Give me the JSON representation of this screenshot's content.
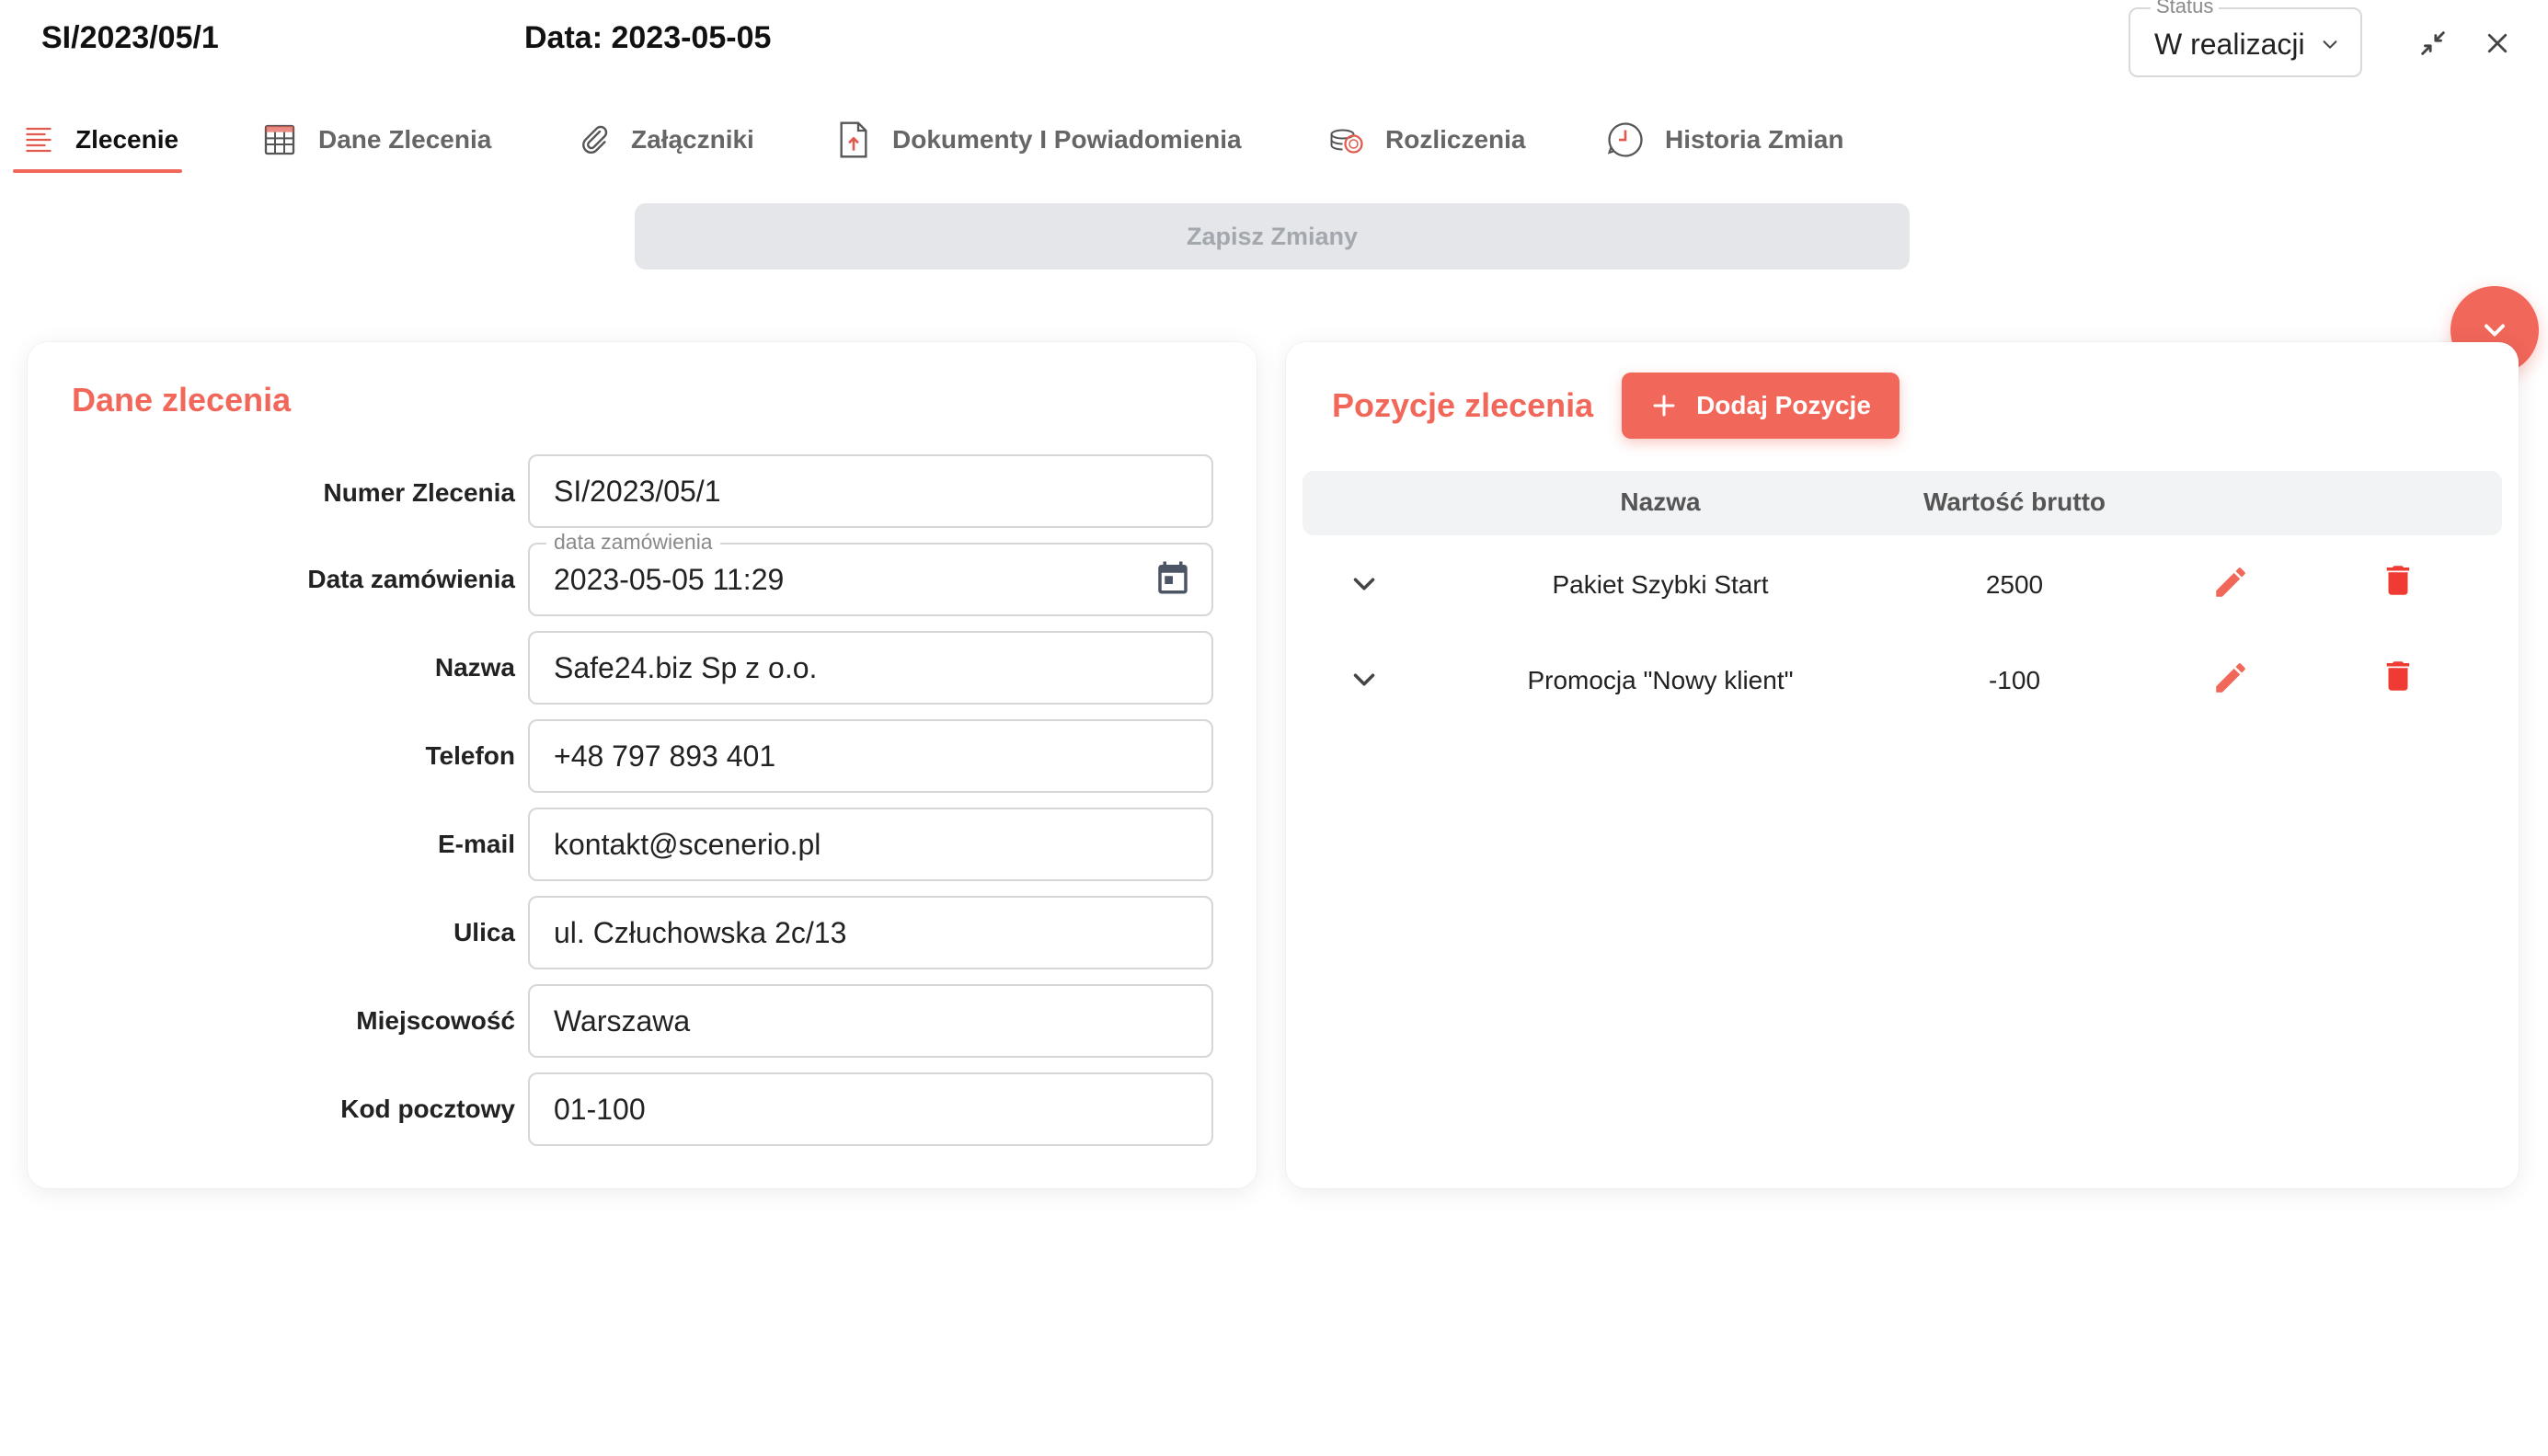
{
  "header": {
    "order_number": "SI/2023/05/1",
    "date_text": "Data: 2023-05-05",
    "status_label": "Status",
    "status_value": "W realizacji"
  },
  "tabs": [
    {
      "label": "Zlecenie",
      "icon": "list-lines-icon",
      "active": true
    },
    {
      "label": "Dane Zlecenia",
      "icon": "table-grid-icon",
      "active": false
    },
    {
      "label": "Załączniki",
      "icon": "paperclip-icon",
      "active": false
    },
    {
      "label": "Dokumenty I Powiadomienia",
      "icon": "document-upload-icon",
      "active": false
    },
    {
      "label": "Rozliczenia",
      "icon": "coins-icon",
      "active": false
    },
    {
      "label": "Historia Zmian",
      "icon": "history-clock-icon",
      "active": false
    }
  ],
  "save_button": "Zapisz Zmiany",
  "order_form": {
    "title": "Dane zlecenia",
    "fields": [
      {
        "label": "Numer Zlecenia",
        "value": "SI/2023/05/1"
      },
      {
        "label": "Data zamówienia",
        "value": "2023-05-05 11:29",
        "floating_label": "data zamówienia"
      },
      {
        "label": "Nazwa",
        "value": "Safe24.biz Sp z o.o."
      },
      {
        "label": "Telefon",
        "value": "+48 797 893 401"
      },
      {
        "label": "E-mail",
        "value": "kontakt@scenerio.pl"
      },
      {
        "label": "Ulica",
        "value": "ul. Człuchowska 2c/13"
      },
      {
        "label": "Miejscowość",
        "value": "Warszawa"
      },
      {
        "label": "Kod pocztowy",
        "value": "01-100"
      }
    ]
  },
  "positions": {
    "title": "Pozycje zlecenia",
    "add_button": "Dodaj Pozycje",
    "columns": [
      "Nazwa",
      "Wartość brutto"
    ],
    "rows": [
      {
        "name": "Pakiet Szybki Start",
        "value": "2500"
      },
      {
        "name": "Promocja \"Nowy klient\"",
        "value": "-100"
      }
    ]
  },
  "colors": {
    "accent": "#f1675a",
    "delete": "#ef3b34",
    "disabled_bg": "#e4e6e9"
  }
}
